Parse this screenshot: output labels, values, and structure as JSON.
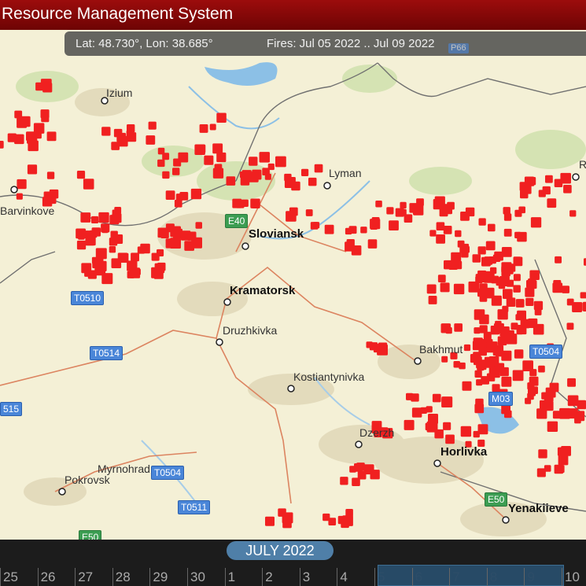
{
  "header": {
    "title": "Resource Management System"
  },
  "coords": {
    "lat": "Lat: 48.730°, Lon: 38.685°",
    "fires": "Fires: Jul 05 2022 .. Jul 09 2022"
  },
  "map": {
    "colors": {
      "land": "#f4f0d6",
      "urban": "#e3dbbc",
      "forest": "#d5e3b3",
      "water": "#8cc0e6",
      "fire": "#f02020",
      "border": "#707070",
      "road": "#dc8460"
    },
    "cities": [
      {
        "name": "Izium",
        "class": "minor"
      },
      {
        "name": "Lyman",
        "class": "minor"
      },
      {
        "name": "Barvinkove",
        "class": "minor"
      },
      {
        "name": "Sloviansk",
        "class": "major"
      },
      {
        "name": "Kramatorsk",
        "class": "major"
      },
      {
        "name": "Druzhkivka",
        "class": "minor"
      },
      {
        "name": "Kostiantynivka",
        "class": "minor"
      },
      {
        "name": "Bakhmut",
        "class": "minor"
      },
      {
        "name": "Dzerzh",
        "class": "minor"
      },
      {
        "name": "Horlivka",
        "class": "major"
      },
      {
        "name": "Myrnohrad",
        "class": "minor"
      },
      {
        "name": "Pokrovsk",
        "class": "minor"
      },
      {
        "name": "Yenakiieve",
        "class": "major"
      },
      {
        "name": "R",
        "class": "minor"
      }
    ],
    "roads": [
      "E40",
      "T0510",
      "T0514",
      "515",
      "T0504",
      "T0504",
      "T0511",
      "E50",
      "E50",
      "E40",
      "P66",
      "M03"
    ]
  },
  "timeline": {
    "month": "JULY 2022",
    "days": [
      "25",
      "26",
      "27",
      "28",
      "29",
      "30",
      "1",
      "2",
      "3",
      "4",
      "5",
      "6",
      "7",
      "8",
      "9",
      "10"
    ],
    "selected": [
      "5",
      "6",
      "7",
      "8",
      "9"
    ]
  }
}
